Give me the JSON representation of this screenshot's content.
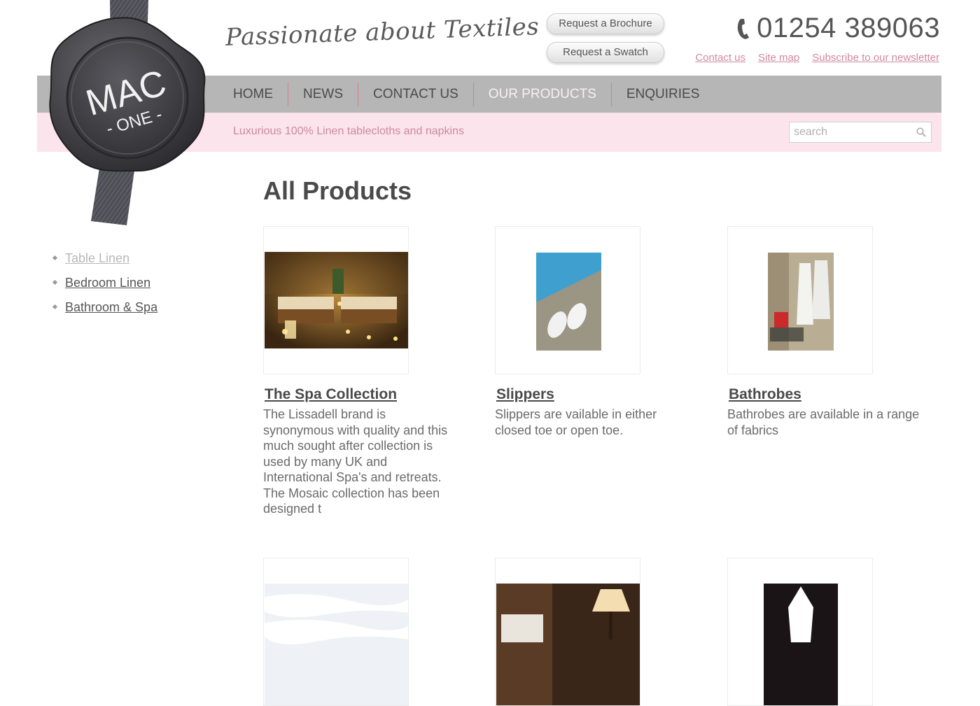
{
  "header": {
    "slogan": "Passionate about Textiles",
    "buttons": [
      "Request a Brochure",
      "Request a Swatch"
    ],
    "phone": "01254 389063",
    "links": [
      "Contact us",
      "Site map",
      "Subscribe to our newsletter"
    ]
  },
  "logo": {
    "line1": "MAC",
    "line2": "- ONE -"
  },
  "nav": {
    "items": [
      {
        "label": "HOME"
      },
      {
        "label": "NEWS"
      },
      {
        "label": "CONTACT US"
      },
      {
        "label": "OUR PRODUCTS",
        "active": true
      },
      {
        "label": "ENQUIRIES"
      }
    ]
  },
  "strip": {
    "tagline": "Luxurious 100% Linen tablecloths and napkins",
    "search_placeholder": "search"
  },
  "sidebar": {
    "items": [
      {
        "label": "Table Linen",
        "current": true
      },
      {
        "label": "Bedroom Linen"
      },
      {
        "label": "Bathroom & Spa"
      }
    ]
  },
  "main": {
    "title": "All Products",
    "products": [
      {
        "title": "The Spa Collection",
        "description": "The Lissadell brand is synonymous with quality and this much sought after collection is used by many UK and International Spa's and retreats. The Mosaic collection has been designed t"
      },
      {
        "title": "Slippers",
        "description": "Slippers are vailable in either closed toe or open toe."
      },
      {
        "title": "Bathrobes",
        "description": "Bathrobes are available in a range of fabrics"
      }
    ]
  },
  "colors": {
    "nav_bg": "#b6b6b6",
    "strip_bg": "#fce4ec",
    "accent_pink": "#d08aa0",
    "text": "#555555"
  }
}
